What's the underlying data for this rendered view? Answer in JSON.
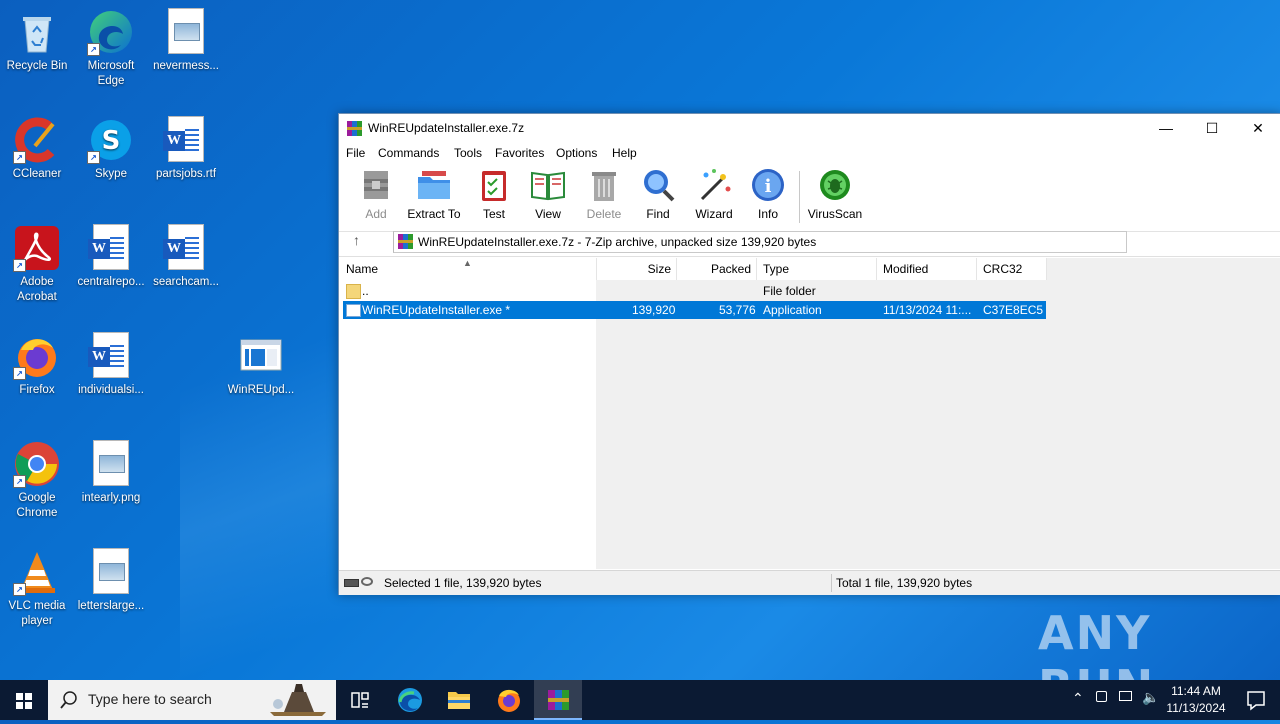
{
  "desktop": {
    "icons": [
      {
        "label": "Recycle Bin",
        "icon": "recycle-bin-icon"
      },
      {
        "label": "Microsoft Edge",
        "icon": "edge-icon"
      },
      {
        "label": "nevermess...",
        "icon": "image-file-icon"
      },
      {
        "label": "CCleaner",
        "icon": "ccleaner-icon"
      },
      {
        "label": "Skype",
        "icon": "skype-icon"
      },
      {
        "label": "partsjobs.rtf",
        "icon": "word-doc-icon"
      },
      {
        "label": "Adobe Acrobat",
        "icon": "acrobat-icon"
      },
      {
        "label": "centralrepo...",
        "icon": "word-doc-icon"
      },
      {
        "label": "searchcam...",
        "icon": "word-doc-icon"
      },
      {
        "label": "Firefox",
        "icon": "firefox-icon"
      },
      {
        "label": "individualsi...",
        "icon": "word-doc-icon"
      },
      {
        "label": "WinREUpd...",
        "icon": "installer-icon"
      },
      {
        "label": "Google Chrome",
        "icon": "chrome-icon"
      },
      {
        "label": "intearly.png",
        "icon": "image-file-icon"
      },
      {
        "label": "VLC media player",
        "icon": "vlc-icon"
      },
      {
        "label": "letterslarge...",
        "icon": "image-file-icon"
      }
    ]
  },
  "window": {
    "title": "WinREUpdateInstaller.exe.7z",
    "menu": [
      "File",
      "Commands",
      "Tools",
      "Favorites",
      "Options",
      "Help"
    ],
    "toolbar": [
      {
        "label": "Add",
        "icon": "add-archive-icon",
        "disabled": true
      },
      {
        "label": "Extract To",
        "icon": "extract-folder-icon",
        "disabled": false
      },
      {
        "label": "Test",
        "icon": "test-clipboard-icon",
        "disabled": false
      },
      {
        "label": "View",
        "icon": "view-book-icon",
        "disabled": false
      },
      {
        "label": "Delete",
        "icon": "delete-trash-icon",
        "disabled": true
      },
      {
        "label": "Find",
        "icon": "find-magnifier-icon",
        "disabled": false
      },
      {
        "label": "Wizard",
        "icon": "wizard-wand-icon",
        "disabled": false
      },
      {
        "label": "Info",
        "icon": "info-icon",
        "disabled": false
      },
      {
        "label": "VirusScan",
        "icon": "virusscan-bug-icon",
        "disabled": false
      }
    ],
    "address": "WinREUpdateInstaller.exe.7z - 7-Zip archive, unpacked size 139,920 bytes",
    "columns": [
      "Name",
      "Size",
      "Packed",
      "Type",
      "Modified",
      "CRC32"
    ],
    "rows": [
      {
        "name": "..",
        "size": "",
        "packed": "",
        "type": "File folder",
        "modified": "",
        "crc": "",
        "selected": false
      },
      {
        "name": "WinREUpdateInstaller.exe *",
        "size": "139,920",
        "packed": "53,776",
        "type": "Application",
        "modified": "11/13/2024 11:...",
        "crc": "C37E8EC5",
        "selected": true
      }
    ],
    "status_left": "Selected 1 file, 139,920 bytes",
    "status_right": "Total 1 file, 139,920 bytes"
  },
  "taskbar": {
    "search_placeholder": "Type here to search",
    "time": "11:44 AM",
    "date": "11/13/2024"
  },
  "watermark": "ANY RUN"
}
